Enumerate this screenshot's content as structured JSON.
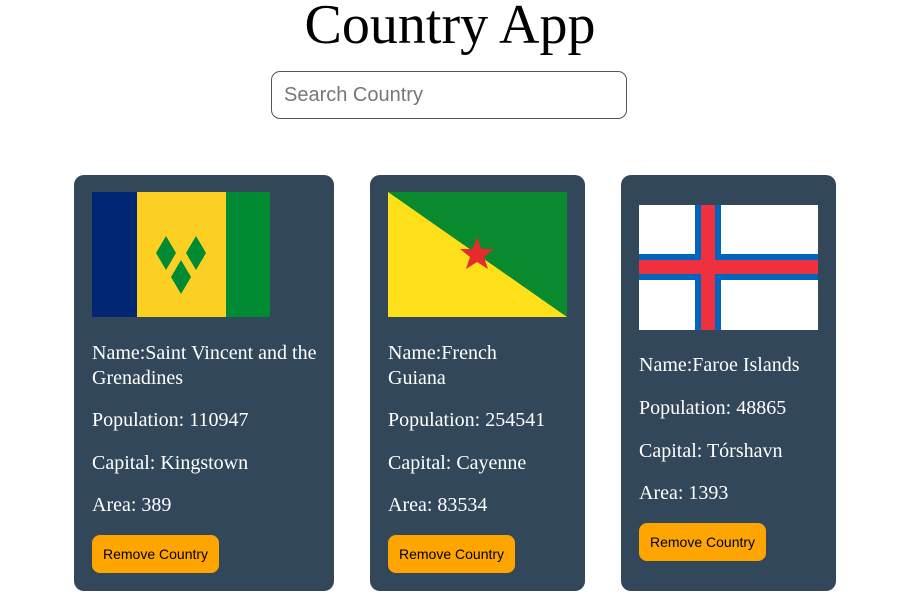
{
  "app": {
    "title": "Country App"
  },
  "search": {
    "placeholder": "Search Country",
    "value": ""
  },
  "countries": [
    {
      "name_label": "Name:Saint Vincent and the Grenadines",
      "population_label": "Population: 110947",
      "capital_label": "Capital: Kingstown",
      "area_label": "Area: 389",
      "remove_label": "Remove Country",
      "flag_icon": "saint-vincent-flag",
      "flag_colors": [
        "#002674",
        "#fcd022",
        "#008a33"
      ]
    },
    {
      "name_label": "Name:French Guiana",
      "population_label": "Population: 254541",
      "capital_label": "Capital: Cayenne",
      "area_label": "Area: 83534",
      "remove_label": "Remove Country",
      "flag_icon": "french-guiana-flag",
      "flag_colors": [
        "#0a8a2e",
        "#fde019",
        "#e52b2b"
      ]
    },
    {
      "name_label": "Name:Faroe Islands",
      "population_label": "Population: 48865",
      "capital_label": "Capital: Tórshavn",
      "area_label": "Area: 1393",
      "remove_label": "Remove Country",
      "flag_icon": "faroe-islands-flag",
      "flag_colors": [
        "#ffffff",
        "#0065bd",
        "#ef303e"
      ]
    }
  ],
  "colors": {
    "card_bg": "#33475b",
    "button_bg": "#ffa500",
    "text_on_card": "#ffffff"
  }
}
